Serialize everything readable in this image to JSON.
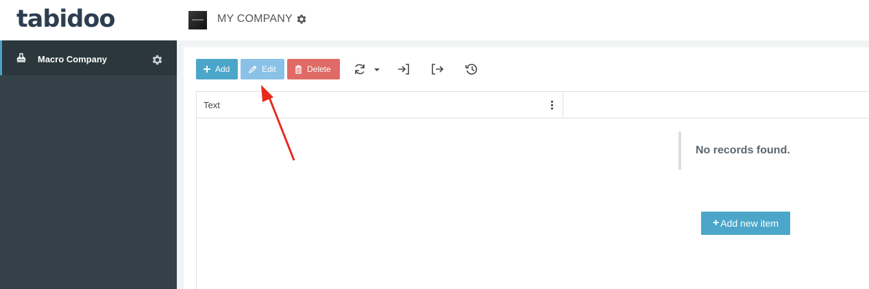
{
  "header": {
    "logo_text": "tabidoo",
    "company_name": "MY COMPANY",
    "company_settings_icon": "gear-icon"
  },
  "sidebar": {
    "items": [
      {
        "label": "Macro Company",
        "icon": "stamp-icon",
        "settings_icon": "gear-icon"
      }
    ]
  },
  "toolbar": {
    "add_label": "Add",
    "edit_label": "Edit",
    "delete_label": "Delete",
    "icons": [
      "refresh-icon",
      "chevron-down-icon",
      "import-icon",
      "export-icon",
      "history-icon"
    ]
  },
  "grid": {
    "columns": [
      {
        "label": "Text"
      }
    ],
    "empty_message": "No records found.",
    "add_new_label": "Add new item",
    "add_new_plus": "+"
  },
  "colors": {
    "primary": "#4ba6c9",
    "edit": "#8ac1e6",
    "danger": "#e06a65",
    "sidebar": "#344148",
    "annotation": "#e8281c"
  }
}
